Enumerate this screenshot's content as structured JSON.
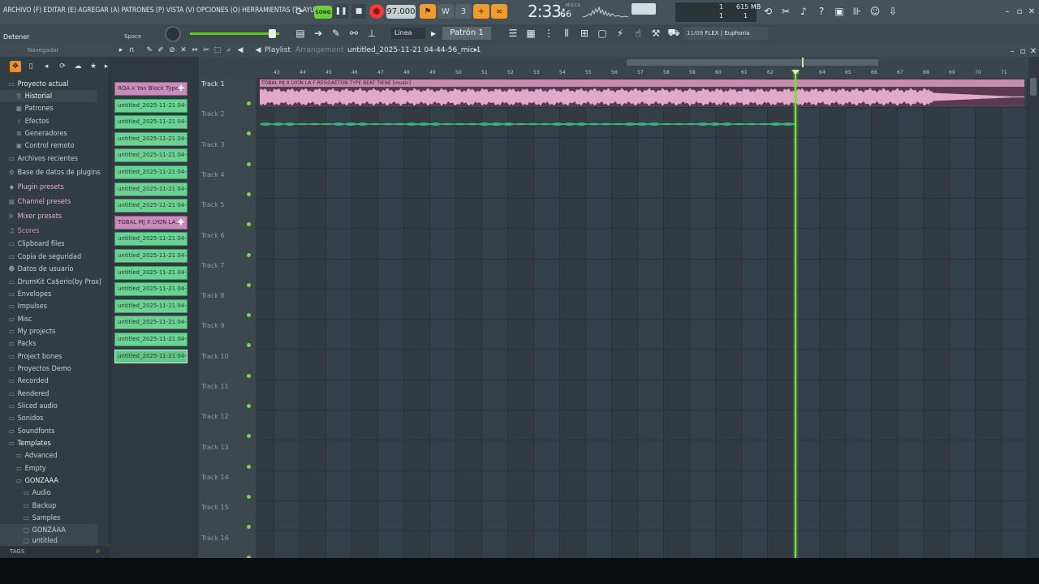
{
  "menu": {
    "items": "ARCHIVO (F) EDITAR (E) AGREGAR (A) PATRONES (P) VISTA (V) OPCIONES (O) HERRAMIENTAS (T) AYUDA"
  },
  "hint": {
    "text": "Detener",
    "key": "Space"
  },
  "transport": {
    "song_label": "SONG",
    "tempo": "97.000",
    "time_main": "2:33:",
    "time_ms": "66",
    "time_label": "M:S:CS"
  },
  "monitor": {
    "cpu": "1",
    "ram": "615 MB",
    "cpu2": "1",
    "ram2": "1"
  },
  "toolbar2": {
    "snap": "Línea",
    "pattern": "Patrón 1",
    "hint_count": "11/09",
    "hint_text": "FLEX | Euphoria"
  },
  "browser": {
    "header": "Navegador",
    "items": [
      {
        "label": "Proyecto actual",
        "icon": "folder-icon"
      },
      {
        "label": "Historial",
        "icon": "history-icon"
      },
      {
        "label": "Patrones",
        "icon": "pattern-icon"
      },
      {
        "label": "Efectos",
        "icon": "effects-icon"
      },
      {
        "label": "Generadores",
        "icon": "generator-icon"
      },
      {
        "label": "Control remoto",
        "icon": "remote-icon"
      },
      {
        "label": "Archivos recientes",
        "icon": "folder-icon"
      },
      {
        "label": "Base de datos de plugins",
        "icon": "plugin-db-icon"
      },
      {
        "label": "Plugin presets",
        "icon": "plugin-preset-icon"
      },
      {
        "label": "Channel presets",
        "icon": "channel-preset-icon"
      },
      {
        "label": "Mixer presets",
        "icon": "mixer-preset-icon"
      },
      {
        "label": "Scores",
        "icon": "scores-icon"
      },
      {
        "label": "Clipboard files",
        "icon": "folder-icon"
      },
      {
        "label": "Copia de seguridad",
        "icon": "folder-icon"
      },
      {
        "label": "Datos de usuario",
        "icon": "user-icon"
      },
      {
        "label": "DrumKit Ca$erio(by Prox)",
        "icon": "folder-icon"
      },
      {
        "label": "Envelopes",
        "icon": "folder-icon"
      },
      {
        "label": "Impulses",
        "icon": "folder-icon"
      },
      {
        "label": "Misc",
        "icon": "folder-icon"
      },
      {
        "label": "My projects",
        "icon": "folder-icon"
      },
      {
        "label": "Packs",
        "icon": "folder-icon"
      },
      {
        "label": "Project bones",
        "icon": "folder-icon"
      },
      {
        "label": "Proyectos Demo",
        "icon": "folder-icon"
      },
      {
        "label": "Recorded",
        "icon": "folder-icon"
      },
      {
        "label": "Rendered",
        "icon": "folder-icon"
      },
      {
        "label": "Sliced audio",
        "icon": "folder-icon"
      },
      {
        "label": "Sonidos",
        "icon": "folder-icon"
      },
      {
        "label": "Soundfonts",
        "icon": "folder-icon"
      },
      {
        "label": "Templates",
        "icon": "folder-icon"
      },
      {
        "label": "Advanced",
        "icon": "folder-icon"
      },
      {
        "label": "Empty",
        "icon": "folder-icon"
      },
      {
        "label": "GONZAAA",
        "icon": "folder-icon"
      },
      {
        "label": "Audio",
        "icon": "folder-icon"
      },
      {
        "label": "Backup",
        "icon": "folder-icon"
      },
      {
        "label": "Samples",
        "icon": "folder-icon"
      },
      {
        "label": "GONZAAA",
        "icon": "file-icon"
      },
      {
        "label": "untitled",
        "icon": "file-icon"
      }
    ],
    "footer": "TAGS"
  },
  "playlist": {
    "title": "Playlist",
    "arrangement": "Arrangement",
    "song_name": "untitled_2025-11-21 04-44-56_mic 1",
    "clips": [
      "ROA x Yan Block Type...",
      "untitled_2025-11-21 04-...",
      "untitled_2025-11-21 04-...",
      "untitled_2025-11-21 04-...",
      "untitled_2025-11-21 04-...",
      "untitled_2025-11-21 04-...",
      "untitled_2025-11-21 04-...",
      "untitled_2025-11-21 04-...",
      "TOBAL MJ X LYON LA...",
      "untitled_2025-11-21 04-...",
      "untitled_2025-11-21 04-...",
      "untitled_2025-11-21 04-...",
      "untitled_2025-11-21 04-...",
      "untitled_2025-11-21 04-...",
      "untitled_2025-11-21 04-...",
      "untitled_2025-11-21 04-...",
      "untitled_2025-11-21 04-..."
    ],
    "tracks": [
      "Track 1",
      "Track 2",
      "Track 3",
      "Track 4",
      "Track 5",
      "Track 6",
      "Track 7",
      "Track 8",
      "Track 9",
      "Track 10",
      "Track 11",
      "Track 12",
      "Track 13",
      "Track 14",
      "Track 15",
      "Track 16"
    ],
    "bars": [
      "43",
      "44",
      "45",
      "46",
      "47",
      "48",
      "49",
      "50",
      "51",
      "52",
      "53",
      "54",
      "55",
      "56",
      "57",
      "58",
      "59",
      "60",
      "61",
      "62",
      "63",
      "64",
      "65",
      "66",
      "67",
      "68",
      "69",
      "70",
      "71"
    ],
    "audio_clip_title": "TOBAL MJ X LYON LA F REGGAETON TYPE BEAT TIENE [music]",
    "playhead_bar": 63,
    "colors": {
      "audio_clip": "#c48dad",
      "clip_green": "#6bd195",
      "playhead": "#7fdc3a"
    }
  }
}
